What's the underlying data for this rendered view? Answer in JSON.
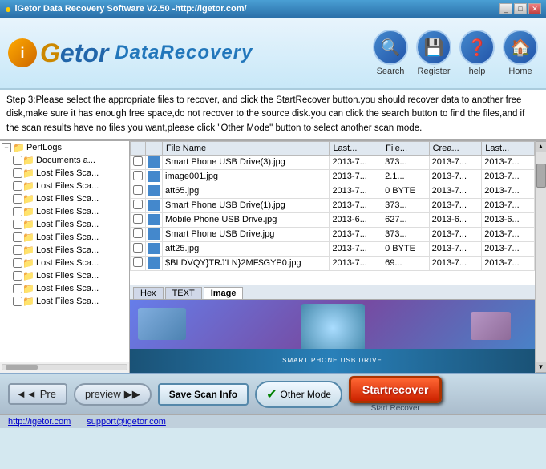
{
  "titleBar": {
    "title": "iGetor Data Recovery Software V2.50 -http://igetor.com/",
    "controls": [
      "minimize",
      "maximize",
      "close"
    ]
  },
  "logo": {
    "brand": "iGetor",
    "product": "DataRecovery"
  },
  "nav": {
    "items": [
      {
        "id": "search",
        "icon": "🔍",
        "label": "Search"
      },
      {
        "id": "register",
        "icon": "💾",
        "label": "Register"
      },
      {
        "id": "help",
        "icon": "❓",
        "label": "help"
      },
      {
        "id": "home",
        "icon": "🏠",
        "label": "Home"
      }
    ]
  },
  "instruction": "Step 3:Please select the appropriate files to recover, and click the StartRecover button.you should recover data to another free disk,make sure it has enough free space,do not recover to the source disk.you can click the search button to find the files,and if the scan results have no files you want,please click \"Other Mode\" button to select another scan mode.",
  "tree": {
    "items": [
      {
        "label": "PerfLogs",
        "level": 0,
        "expanded": true
      },
      {
        "label": "Documents a...",
        "level": 1
      },
      {
        "label": "Lost Files Sca...",
        "level": 1
      },
      {
        "label": "Lost Files Sca...",
        "level": 1
      },
      {
        "label": "Lost Files Sca...",
        "level": 1
      },
      {
        "label": "Lost Files Sca...",
        "level": 1
      },
      {
        "label": "Lost Files Sca...",
        "level": 1
      },
      {
        "label": "Lost Files Sca...",
        "level": 1
      },
      {
        "label": "Lost Files Sca...",
        "level": 1
      },
      {
        "label": "Lost Files Sca...",
        "level": 1
      },
      {
        "label": "Lost Files Sca...",
        "level": 1
      },
      {
        "label": "Lost Files Sca...",
        "level": 1
      },
      {
        "label": "Lost Files Sca...",
        "level": 1
      }
    ]
  },
  "fileTable": {
    "columns": [
      "",
      "",
      "File Name",
      "Last...",
      "File...",
      "Crea...",
      "Last..."
    ],
    "rows": [
      {
        "checked": false,
        "name": "Smart Phone USB Drive(3).jpg",
        "last": "2013-7...",
        "size": "373...",
        "created": "2013-7...",
        "lastmod": "2013-7..."
      },
      {
        "checked": false,
        "name": "image001.jpg",
        "last": "2013-7...",
        "size": "2.1...",
        "created": "2013-7...",
        "lastmod": "2013-7..."
      },
      {
        "checked": false,
        "name": "att65.jpg",
        "last": "2013-7...",
        "size": "0 BYTE",
        "created": "2013-7...",
        "lastmod": "2013-7..."
      },
      {
        "checked": false,
        "name": "Smart Phone USB Drive(1).jpg",
        "last": "2013-7...",
        "size": "373...",
        "created": "2013-7...",
        "lastmod": "2013-7..."
      },
      {
        "checked": false,
        "name": "Mobile Phone USB Drive.jpg",
        "last": "2013-6...",
        "size": "627...",
        "created": "2013-6...",
        "lastmod": "2013-6..."
      },
      {
        "checked": false,
        "name": "Smart Phone USB Drive.jpg",
        "last": "2013-7...",
        "size": "373...",
        "created": "2013-7...",
        "lastmod": "2013-7..."
      },
      {
        "checked": false,
        "name": "att25.jpg",
        "last": "2013-7...",
        "size": "0 BYTE",
        "created": "2013-7...",
        "lastmod": "2013-7..."
      },
      {
        "checked": false,
        "name": "$BLDVQY}TRJ'LN}2MF$GYP0.jpg",
        "last": "2013-7...",
        "size": "69...",
        "created": "2013-7...",
        "lastmod": "2013-7..."
      }
    ]
  },
  "preview": {
    "tabs": [
      "Hex",
      "TEXT",
      "Image"
    ],
    "activeTab": "Image"
  },
  "bottomBar": {
    "preLabel": "Pre",
    "preArrows": "◄◄",
    "nextArrows": "▶▶",
    "previewLabel": "preview",
    "saveScanLabel": "Save Scan Info",
    "otherModeLabel": "Other Mode",
    "startRecoverLabel": "Startrecover",
    "startRecoverSub": "Start Recover"
  },
  "footer": {
    "website": "http://igetor.com",
    "email": "support@igetor.com"
  }
}
